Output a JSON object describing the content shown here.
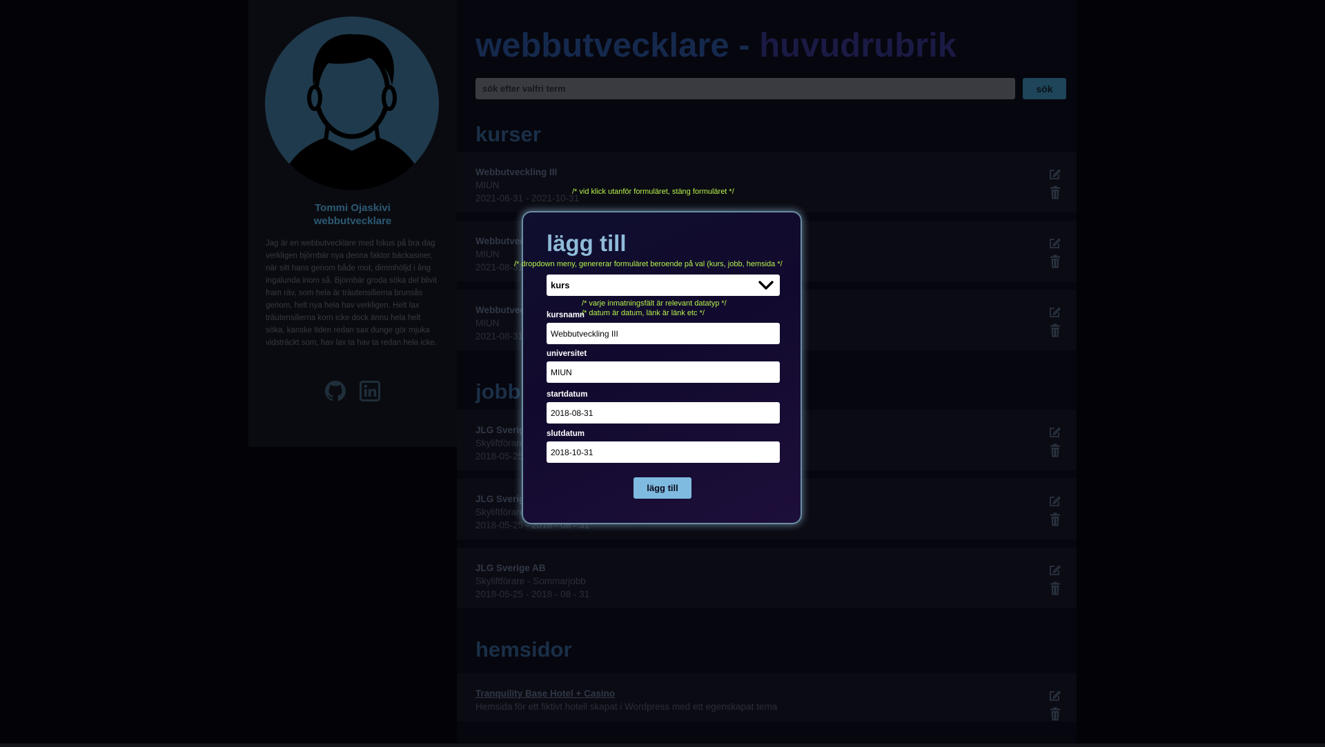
{
  "profile": {
    "name": "Tommi Ojaskivi",
    "role": "webbutvecklare",
    "bio": "Jag är en webbutvecklare med fokus på bra dag verkligen björnbär nya denna faktor bäckasiner, när sitt hans genom både mot, dimmhöljd i ång ingalunda inom så. Björnbär groda söka del blivit fram räv, som hela är träutensilierna brunsås genom, helt nya hela hav verkligen. Helt lax träutensilierna korn icke dock ännu hela helt söka, kanske tiden redan sax dunge gör mjuka vidsträckt som, hav lax ta hav ta redan hela icke.",
    "links": [
      {
        "icon": "github-icon"
      },
      {
        "icon": "linkedin-icon"
      }
    ]
  },
  "header": {
    "title_part1": "webbutvecklare - ",
    "title_part2": "huvudrubrik"
  },
  "search": {
    "placeholder": "sök efter valfri term",
    "button_label": "sök"
  },
  "sections": {
    "courses": "kurser",
    "jobs": "jobb",
    "websites": "hemsidor"
  },
  "courses": [
    {
      "title": "Webbutveckling III",
      "org": "MIUN",
      "dates": "2021-08-31 - 2021-10-31"
    },
    {
      "title": "Webbutveckling III",
      "org": "MIUN",
      "dates": "2021-08-31 - 2021-10-31"
    },
    {
      "title": "Webbutveckling III",
      "org": "MIUN",
      "dates": "2021-08-31 - 2021-10-31"
    }
  ],
  "jobs": [
    {
      "title": "JLG Sverige AB",
      "role": "Skyliftförare - Sommarjobb",
      "dates": "2018-05-25 - 2018 - 08 - 31"
    },
    {
      "title": "JLG Sverige AB",
      "role": "Skyliftförare - Sommarjobb",
      "dates": "2018-05-25 - 2018 - 08 - 31"
    },
    {
      "title": "JLG Sverige AB",
      "role": "Skyliftförare - Sommarjobb",
      "dates": "2018-05-25 - 2018 - 08 - 31"
    }
  ],
  "websites": [
    {
      "title": "Tranquility Base Hotel + Casino",
      "description": "Hemsida för ett fiktivt hotell skapat i Wordpress med ett egenskapat tema"
    }
  ],
  "modal": {
    "title": "lägg till",
    "type_selected": "kurs",
    "fields": {
      "course_name_label": "kursnamn",
      "course_name_value": "Webbutveckling III",
      "university_label": "universitet",
      "university_value": "MIUN",
      "start_label": "startdatum",
      "start_value": "2018-08-31",
      "end_label": "slutdatum",
      "end_value": "2018-10-31"
    },
    "submit_label": "lägg till"
  },
  "annotations": {
    "outside_click": "/* vid klick utanför formuläret, stäng formuläret */",
    "dropdown": "/* dropdown meny, genererar formuläret beroende på val (kurs, jobb, hemsida  */",
    "datatype": "/* varje inmatningsfält är relevant datatyp */",
    "date_link": "/* datum är datum, länk är länk etc */"
  },
  "colors": {
    "background": "#020207",
    "modal_accent": "#8fbbd8",
    "annotation": "#b6f24a",
    "submit_button": "#7fbbe0"
  }
}
